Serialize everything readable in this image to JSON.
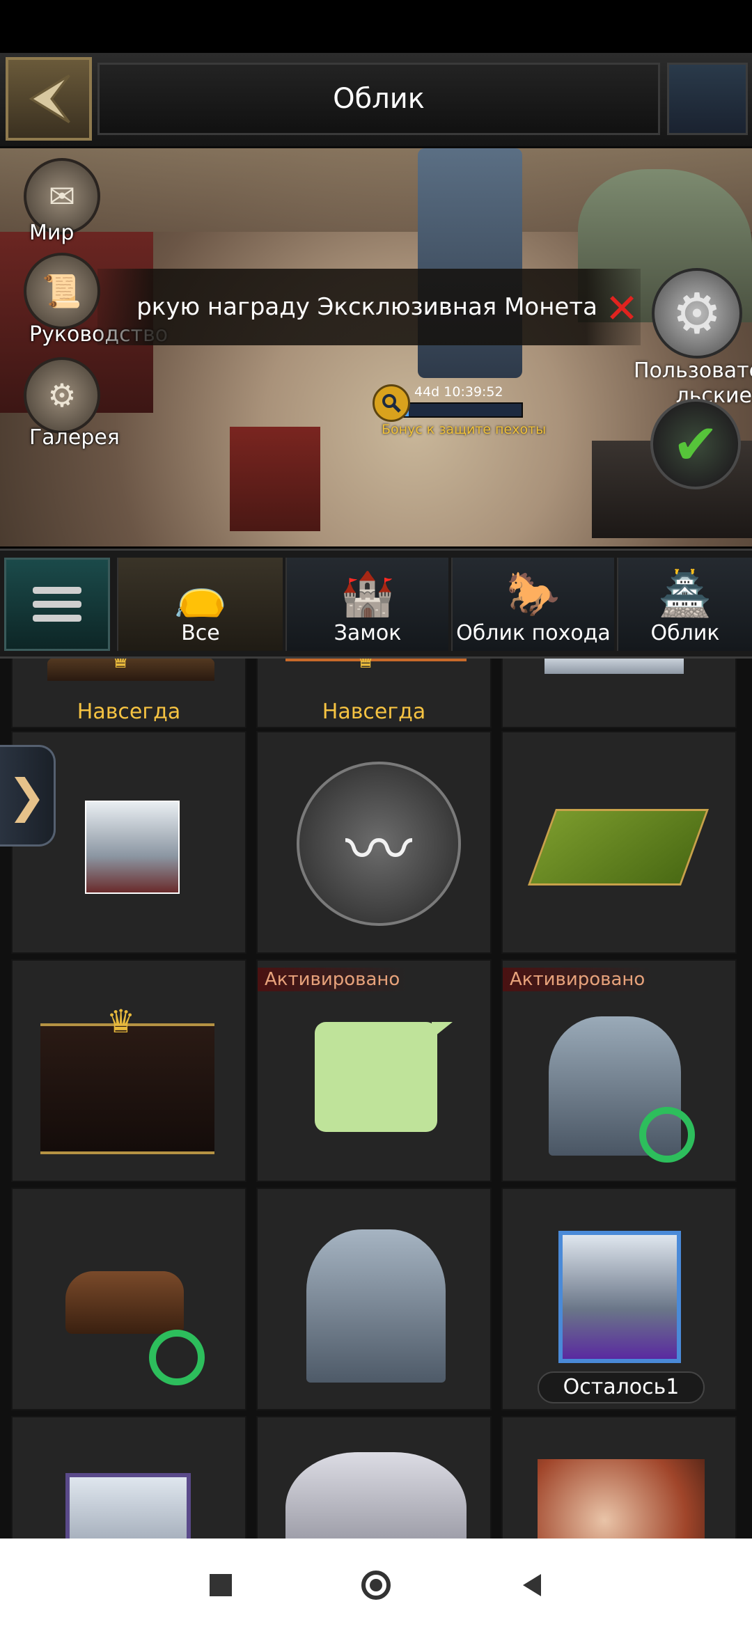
{
  "header": {
    "title": "Облик"
  },
  "side_menu": [
    {
      "label": "Мир",
      "icon": "map-scroll-icon"
    },
    {
      "label": "Руководство",
      "icon": "scroll-icon"
    },
    {
      "label": "Галерея",
      "icon": "gallery-icon"
    }
  ],
  "banner": {
    "text": "ркую награду Эксклюзивная Монета"
  },
  "timer": {
    "text": "44d 10:39:52",
    "bonus": "Бонус к защите пехоты",
    "progress": 0.06
  },
  "custom_button": {
    "label_line1": "Пользовате",
    "label_line2": "льские"
  },
  "tabs": [
    {
      "label": "Все",
      "active": true
    },
    {
      "label": "Замок",
      "active": false
    },
    {
      "label": "Облик похода",
      "active": false
    },
    {
      "label": "Облик",
      "active": false
    }
  ],
  "grid": {
    "forever_label": "Навсегда",
    "activated_label": "Активировано",
    "remaining_label": "Осталось1"
  }
}
